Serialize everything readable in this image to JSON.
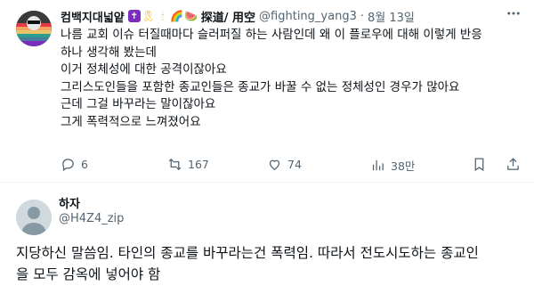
{
  "tweet": {
    "display_name": "컴백지대넓얕",
    "badges": [
      "✝",
      "🎗",
      "🕯",
      "🌈",
      "🍉"
    ],
    "name_suffix": "探道/ 用空",
    "handle": "@fighting_yang3",
    "separator": "·",
    "date": "8월 13일",
    "more_icon": "more-dots-icon",
    "lines": [
      "나름 교회 이슈 터질때마다 슬러퍼질 하는 사람인데 왜 이 플로우에 대해 이렇게 반응",
      "하나 생각해 봤는데",
      "이거 정체성에 대한 공격이잖아요",
      "그리스도인들을 포함한 종교인들은 종교가 바꿀 수 없는 정체성인 경우가 많아요",
      "근데 그걸 바꾸라는 말이잖아요",
      "그게 폭력적으로 느껴졌어요"
    ],
    "actions": {
      "reply_count": "6",
      "retweet_count": "167",
      "like_count": "74",
      "views_count": "38만"
    }
  },
  "reply": {
    "display_name": "하자",
    "handle": "@H4Z4_zip",
    "lines": [
      "지당하신 말씀임. 타인의 종교를 바꾸라는건 폭력임. 따라서 전도시도하는 종교인",
      "을 모두 감옥에 넣어야 함"
    ]
  },
  "colors": {
    "text": "#0f1419",
    "muted": "#536471",
    "divider": "#eff3f4",
    "avatar_placeholder": "#cfd9de"
  }
}
